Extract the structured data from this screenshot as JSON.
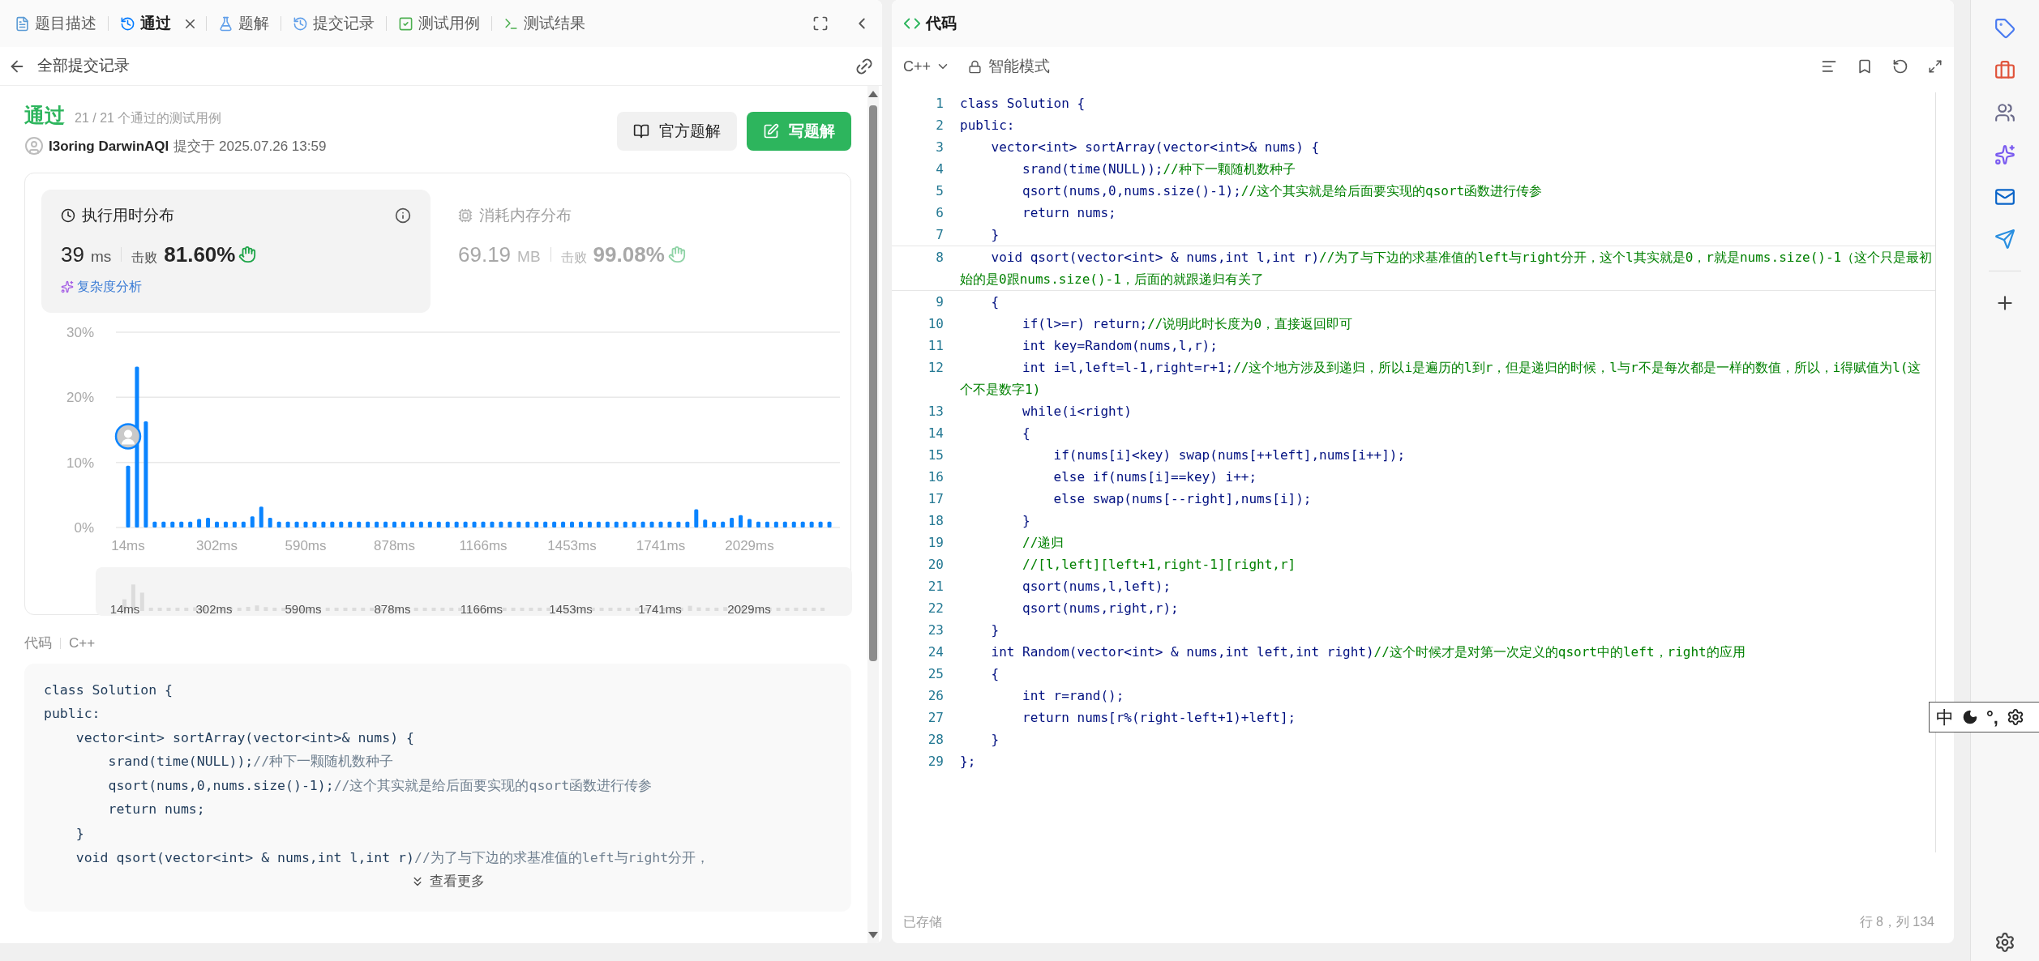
{
  "left_panel": {
    "tabs": [
      {
        "label": "题目描述",
        "selected": false,
        "closable": false
      },
      {
        "label": "通过",
        "selected": true,
        "closable": true
      },
      {
        "label": "题解",
        "selected": false,
        "closable": false
      },
      {
        "label": "提交记录",
        "selected": false,
        "closable": false
      },
      {
        "label": "测试用例",
        "selected": false,
        "closable": false
      },
      {
        "label": "测试结果",
        "selected": false,
        "closable": false
      }
    ],
    "back_link": "全部提交记录",
    "submission": {
      "status": "通过",
      "cases": "21 / 21 个通过的测试用例",
      "user": "I3oring DarwinAQI",
      "submitted": "提交于 2025.07.26 13:59"
    },
    "buttons": [
      {
        "label": "官方题解",
        "kind": "secondary"
      },
      {
        "label": "写题解",
        "kind": "primary"
      }
    ],
    "stat_cards": [
      {
        "kind": "runtime",
        "title": "执行用时分布",
        "value": "39",
        "unit": "ms",
        "beats_label": "击败",
        "beats": "81.60%",
        "link": "复杂度分析",
        "selected": true
      },
      {
        "kind": "memory",
        "title": "消耗内存分布",
        "value": "69.19",
        "unit": "MB",
        "beats_label": "击败",
        "beats": "99.08%",
        "selected": false
      }
    ],
    "chart_data": {
      "type": "bar",
      "yticks": [
        {
          "value": 0,
          "label": "0%"
        },
        {
          "value": 10,
          "label": "10%"
        },
        {
          "value": 20,
          "label": "20%"
        },
        {
          "value": 30,
          "label": "30%"
        }
      ],
      "ylim": [
        0,
        30
      ],
      "categories": [
        "14ms",
        null,
        null,
        null,
        null,
        null,
        null,
        null,
        null,
        null,
        "302ms",
        null,
        null,
        null,
        null,
        null,
        null,
        null,
        null,
        null,
        "590ms",
        null,
        null,
        null,
        null,
        null,
        null,
        null,
        null,
        null,
        "878ms",
        null,
        null,
        null,
        null,
        null,
        null,
        null,
        null,
        null,
        "1166ms",
        null,
        null,
        null,
        null,
        null,
        null,
        null,
        null,
        null,
        "1453ms",
        null,
        null,
        null,
        null,
        null,
        null,
        null,
        null,
        null,
        "1741ms",
        null,
        null,
        null,
        null,
        null,
        null,
        null,
        null,
        null,
        "2029ms",
        null,
        null,
        null,
        null,
        null,
        null,
        null,
        null,
        null
      ],
      "series": [
        {
          "color": "#0a84ff",
          "values": [
            9.5,
            24.7,
            16.3,
            0.9,
            0.9,
            0.9,
            0.9,
            0.9,
            1.3,
            1.5,
            0.9,
            0.9,
            0.9,
            0.9,
            1.7,
            3.2,
            1.5,
            0.9,
            0.9,
            0.9,
            0.9,
            0.9,
            0.9,
            0.9,
            0.9,
            0.9,
            0.9,
            0.9,
            0.9,
            0.9,
            0.9,
            0.9,
            0.9,
            0.9,
            0.9,
            0.9,
            0.9,
            0.9,
            0.9,
            0.9,
            0.9,
            0.9,
            0.9,
            0.9,
            0.9,
            0.9,
            0.9,
            0.9,
            0.9,
            0.9,
            0.9,
            0.9,
            0.9,
            0.9,
            0.9,
            0.9,
            0.9,
            0.9,
            0.9,
            0.9,
            0.9,
            0.9,
            0.9,
            0.9,
            2.8,
            1.2,
            0.9,
            0.9,
            1.5,
            1.9,
            1.3,
            0.9,
            0.9,
            0.9,
            0.9,
            0.9,
            0.9,
            0.9,
            0.9,
            0.9
          ]
        }
      ]
    },
    "brush_labels": [
      "14ms",
      "302ms",
      "590ms",
      "878ms",
      "1166ms",
      "1453ms",
      "1741ms",
      "2029ms"
    ],
    "code_preview": {
      "title": "代码",
      "language": "C++",
      "more": "查看更多",
      "lines": [
        {
          "code": "class Solution {"
        },
        {
          "code": "public:"
        },
        {
          "code": "    vector<int> sortArray(vector<int>& nums) {"
        },
        {
          "code": "        srand(time(NULL));",
          "comment": "//种下一颗随机数种子"
        },
        {
          "code": "        qsort(nums,0,nums.size()-1);",
          "comment": "//这个其实就是给后面要实现的qsort函数进行传参"
        },
        {
          "code": "        return nums;"
        },
        {
          "code": "    }"
        },
        {
          "code": "    void qsort(vector<int> & nums,int l,int r)",
          "comment": "//为了与下边的求基准值的left与right分开，"
        }
      ]
    }
  },
  "editor": {
    "title": "代码",
    "language": "C++",
    "mode": "智能模式",
    "lines": [
      {
        "number": "1",
        "code": "class Solution {"
      },
      {
        "number": "2",
        "code": "public:"
      },
      {
        "number": "3",
        "code": "    vector<int> sortArray(vector<int>& nums) {"
      },
      {
        "number": "4",
        "code": "        srand(time(NULL));",
        "comment": "//种下一颗随机数种子"
      },
      {
        "number": "5",
        "code": "        qsort(nums,0,nums.size()-1);",
        "comment": "//这个其实就是给后面要实现的qsort函数进行传参"
      },
      {
        "number": "6",
        "code": "        return nums;"
      },
      {
        "number": "7",
        "code": "    }"
      },
      {
        "number": "8",
        "code": "    void qsort(vector<int> & nums,int l,int r)",
        "comment": "//为了与下边的求基准值的left与right分开，这个l其实就是0，r就是nums.size()-1（这个只是最初始的是0跟nums.size()-1，后面的就跟递归有关了"
      },
      {
        "number": "9",
        "code": "    {"
      },
      {
        "number": "10",
        "code": "        if(l>=r) return;",
        "comment": "//说明此时长度为0，直接返回即可"
      },
      {
        "number": "11",
        "code": "        int key=Random(nums,l,r);"
      },
      {
        "number": "12",
        "code": "        int i=l,left=l-1,right=r+1;",
        "comment": "//这个地方涉及到递归，所以i是遍历的l到r，但是递归的时候，l与r不是每次都是一样的数值，所以，i得赋值为l(这个不是数字1)"
      },
      {
        "number": "13",
        "code": "        while(i<right)"
      },
      {
        "number": "14",
        "code": "        {"
      },
      {
        "number": "15",
        "code": "            if(nums[i]<key) swap(nums[++left],nums[i++]);"
      },
      {
        "number": "16",
        "code": "            else if(nums[i]==key) i++;"
      },
      {
        "number": "17",
        "code": "            else swap(nums[--right],nums[i]);"
      },
      {
        "number": "18",
        "code": "        }"
      },
      {
        "number": "19",
        "comment": "        //递归"
      },
      {
        "number": "20",
        "comment": "        //[l,left][left+1,right-1][right,r]"
      },
      {
        "number": "21",
        "code": "        qsort(nums,l,left);"
      },
      {
        "number": "22",
        "code": "        qsort(nums,right,r);"
      },
      {
        "number": "23",
        "code": "    }"
      },
      {
        "number": "24",
        "code": "    int Random(vector<int> & nums,int left,int right)",
        "comment": "//这个时候才是对第一次定义的qsort中的left，right的应用"
      },
      {
        "number": "25",
        "code": "    {"
      },
      {
        "number": "26",
        "code": "        int r=rand();"
      },
      {
        "number": "27",
        "code": "        return nums[r%(right-left+1)+left];"
      },
      {
        "number": "28",
        "code": "    }"
      },
      {
        "number": "29",
        "code": "};"
      }
    ],
    "saved": "已存储",
    "cursor": "行 8，列 134"
  },
  "ime_toolbar": {
    "mode": "中",
    "punctuation": "°,"
  }
}
